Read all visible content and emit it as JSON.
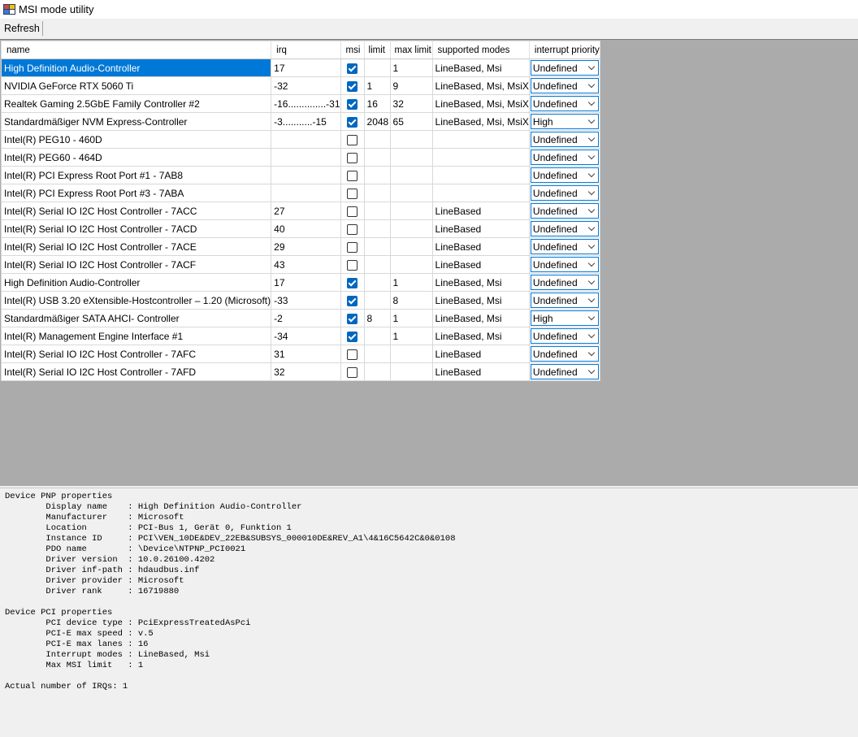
{
  "window": {
    "title": "MSI mode utility"
  },
  "toolbar": {
    "refresh_label": "Refresh"
  },
  "columns": {
    "name": "name",
    "irq": "irq",
    "msi": "msi",
    "limit": "limit",
    "max_limit": "max limit",
    "supported_modes": "supported modes",
    "interrupt_priority": "interrupt priority"
  },
  "rows": [
    {
      "name": "High Definition Audio-Controller",
      "irq": "17",
      "msi": true,
      "limit": "",
      "max_limit": "1",
      "modes": "LineBased, Msi",
      "priority": "Undefined"
    },
    {
      "name": "NVIDIA GeForce RTX 5060 Ti",
      "irq": "-32",
      "msi": true,
      "limit": "1",
      "max_limit": "9",
      "modes": "LineBased, Msi, MsiX",
      "priority": "Undefined"
    },
    {
      "name": "Realtek Gaming 2.5GbE Family Controller #2",
      "irq": "-16..............-31",
      "msi": true,
      "limit": "16",
      "max_limit": "32",
      "modes": "LineBased, Msi, MsiX",
      "priority": "Undefined"
    },
    {
      "name": "Standardmäßiger NVM Express-Controller",
      "irq": "-3...........-15",
      "msi": true,
      "limit": "2048",
      "max_limit": "65",
      "modes": "LineBased, Msi, MsiX",
      "priority": "High"
    },
    {
      "name": "Intel(R) PEG10 - 460D",
      "irq": "",
      "msi": false,
      "limit": "",
      "max_limit": "",
      "modes": "",
      "priority": "Undefined"
    },
    {
      "name": "Intel(R) PEG60 - 464D",
      "irq": "",
      "msi": false,
      "limit": "",
      "max_limit": "",
      "modes": "",
      "priority": "Undefined"
    },
    {
      "name": "Intel(R) PCI Express Root Port #1 - 7AB8",
      "irq": "",
      "msi": false,
      "limit": "",
      "max_limit": "",
      "modes": "",
      "priority": "Undefined"
    },
    {
      "name": "Intel(R) PCI Express Root Port #3 - 7ABA",
      "irq": "",
      "msi": false,
      "limit": "",
      "max_limit": "",
      "modes": "",
      "priority": "Undefined"
    },
    {
      "name": "Intel(R) Serial IO I2C Host Controller - 7ACC",
      "irq": "27",
      "msi": false,
      "limit": "",
      "max_limit": "",
      "modes": "LineBased",
      "priority": "Undefined"
    },
    {
      "name": "Intel(R) Serial IO I2C Host Controller - 7ACD",
      "irq": "40",
      "msi": false,
      "limit": "",
      "max_limit": "",
      "modes": "LineBased",
      "priority": "Undefined"
    },
    {
      "name": "Intel(R) Serial IO I2C Host Controller - 7ACE",
      "irq": "29",
      "msi": false,
      "limit": "",
      "max_limit": "",
      "modes": "LineBased",
      "priority": "Undefined"
    },
    {
      "name": "Intel(R) Serial IO I2C Host Controller - 7ACF",
      "irq": "43",
      "msi": false,
      "limit": "",
      "max_limit": "",
      "modes": "LineBased",
      "priority": "Undefined"
    },
    {
      "name": "High Definition Audio-Controller",
      "irq": "17",
      "msi": true,
      "limit": "",
      "max_limit": "1",
      "modes": "LineBased, Msi",
      "priority": "Undefined"
    },
    {
      "name": "Intel(R) USB 3.20 eXtensible-Hostcontroller – 1.20 (Microsoft)",
      "irq": "-33",
      "msi": true,
      "limit": "",
      "max_limit": "8",
      "modes": "LineBased, Msi",
      "priority": "Undefined"
    },
    {
      "name": "Standardmäßiger SATA AHCI- Controller",
      "irq": "-2",
      "msi": true,
      "limit": "8",
      "max_limit": "1",
      "modes": "LineBased, Msi",
      "priority": "High"
    },
    {
      "name": "Intel(R) Management Engine Interface #1",
      "irq": "-34",
      "msi": true,
      "limit": "",
      "max_limit": "1",
      "modes": "LineBased, Msi",
      "priority": "Undefined"
    },
    {
      "name": "Intel(R) Serial IO I2C Host Controller - 7AFC",
      "irq": "31",
      "msi": false,
      "limit": "",
      "max_limit": "",
      "modes": "LineBased",
      "priority": "Undefined"
    },
    {
      "name": "Intel(R) Serial IO I2C Host Controller - 7AFD",
      "irq": "32",
      "msi": false,
      "limit": "",
      "max_limit": "",
      "modes": "LineBased",
      "priority": "Undefined"
    }
  ],
  "selected_row": 0,
  "details_text": "Device PNP properties\n        Display name    : High Definition Audio-Controller\n        Manufacturer    : Microsoft\n        Location        : PCI-Bus 1, Gerät 0, Funktion 1\n        Instance ID     : PCI\\VEN_10DE&DEV_22EB&SUBSYS_000010DE&REV_A1\\4&16C5642C&0&0108\n        PDO name        : \\Device\\NTPNP_PCI0021\n        Driver version  : 10.0.26100.4202\n        Driver inf-path : hdaudbus.inf\n        Driver provider : Microsoft\n        Driver rank     : 16719880\n\nDevice PCI properties\n        PCI device type : PciExpressTreatedAsPci\n        PCI-E max speed : v.5\n        PCI-E max lanes : 16\n        Interrupt modes : LineBased, Msi\n        Max MSI limit   : 1\n\nActual number of IRQs: 1"
}
